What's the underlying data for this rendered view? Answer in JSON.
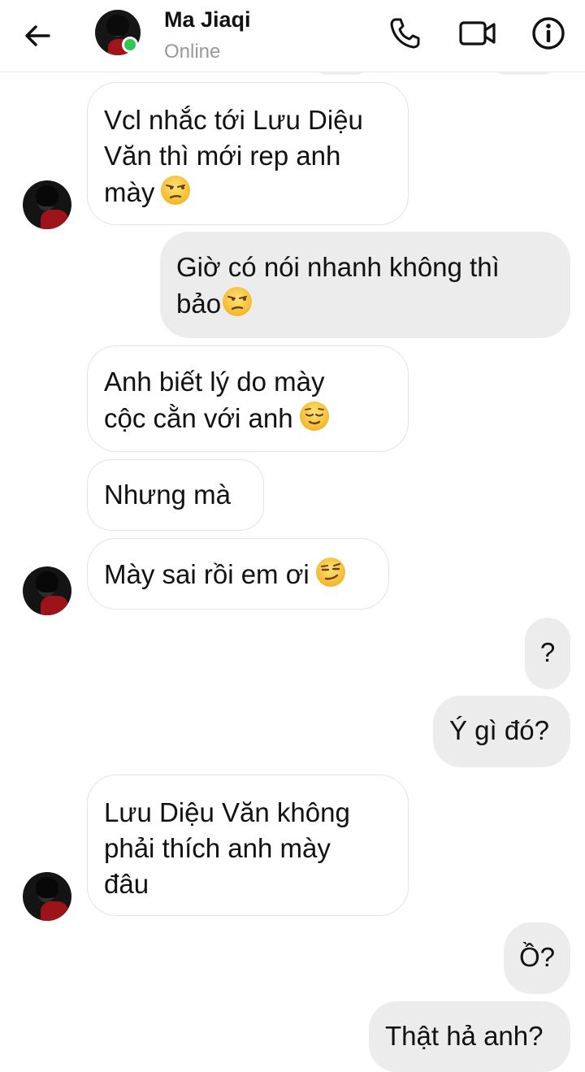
{
  "header": {
    "contact_name": "Ma Jiaqi",
    "status": "Online",
    "icons": [
      "back-arrow-icon",
      "phone-icon",
      "video-camera-icon",
      "info-icon"
    ],
    "online_color": "#31c552"
  },
  "messages": [
    {
      "side": "received",
      "text": "Vcl nhắc tới Lưu Diệu\nVăn thì mới rep anh\nmày",
      "emoji": "unamused-face"
    },
    {
      "side": "sent",
      "text": "Giờ có nói nhanh không thì\nbảo",
      "emoji": "unamused-face"
    },
    {
      "side": "received",
      "text": "Anh biết lý do mày\ncộc cằn với anh",
      "emoji": "relieved-face"
    },
    {
      "side": "received",
      "text": "Nhưng mà"
    },
    {
      "side": "received",
      "text": "Mày sai rồi em ơi",
      "emoji": "smirking-face"
    },
    {
      "side": "sent",
      "text": "?"
    },
    {
      "side": "sent",
      "text": "Ý gì đó?"
    },
    {
      "side": "received",
      "text": "Lưu Diệu Văn không\nphải thích anh mày\nđâu"
    },
    {
      "side": "sent",
      "text": "Ồ?"
    },
    {
      "side": "sent",
      "text": "Thật hả anh?"
    }
  ],
  "colors": {
    "received_bubble": "#ffffff",
    "sent_bubble": "#ececec",
    "emoji_face": "#f7c83a"
  }
}
